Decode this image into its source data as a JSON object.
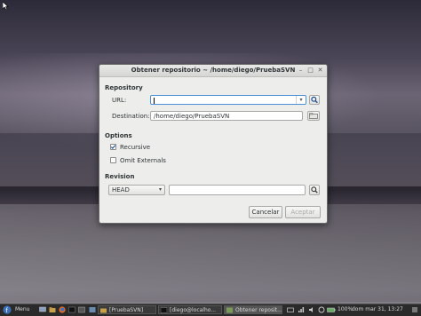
{
  "dialog": {
    "title": "Obtener repositorio ~ /home/diego/PruebaSVN",
    "repository_section": "Repository",
    "url_label": "URL:",
    "url_value": "",
    "destination_label": "Destination:",
    "destination_value": "/home/diego/PruebaSVN",
    "options_section": "Options",
    "recursive_label": "Recursive",
    "recursive_checked": true,
    "omit_externals_label": "Omit Externals",
    "omit_externals_checked": false,
    "revision_section": "Revision",
    "revision_selected": "HEAD",
    "revision_value": "",
    "cancel_label": "Cancelar",
    "accept_label": "Aceptar"
  },
  "taskbar": {
    "menu_label": "Menu",
    "tasks": [
      {
        "label": "[PruebaSVN]"
      },
      {
        "label": "[diego@localho..."
      },
      {
        "label": "Obtener reposit..."
      }
    ],
    "battery": "100%",
    "clock": "dom mar 31, 13:27"
  },
  "colors": {
    "accent": "#4a90d9",
    "taskbar": "#2a2a2a",
    "dialog_bg": "#ededeb"
  }
}
